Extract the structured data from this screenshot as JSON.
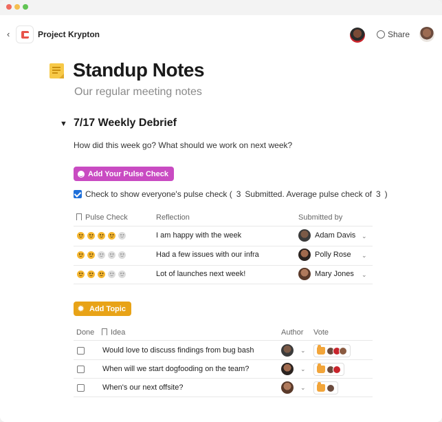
{
  "header": {
    "back_icon": "chevron-left-icon",
    "project_name": "Project Krypton",
    "share_label": "Share",
    "brand_color": "#e8534a"
  },
  "doc": {
    "title": "Standup Notes",
    "subtitle": "Our regular meeting notes",
    "section_title": "7/17 Weekly Debrief",
    "question": "How did this week go? What should we work on next week?"
  },
  "pulse": {
    "button_label": "Add Your Pulse Check",
    "button_color": "#c94bc2",
    "check_text_before": "Check to show everyone's pulse check (",
    "submitted_count": "3",
    "check_text_middle": "Submitted. Average pulse check of",
    "average": "3",
    "check_text_after": ")",
    "checked": true,
    "columns": [
      "Pulse Check",
      "Reflection",
      "Submitted by"
    ],
    "rows": [
      {
        "score": 4,
        "reflection": "I am happy with the week",
        "submitter": "Adam Davis"
      },
      {
        "score": 2,
        "reflection": "Had a few issues with our infra",
        "submitter": "Polly Rose"
      },
      {
        "score": 3,
        "reflection": "Lot of launches next week!",
        "submitter": "Mary Jones"
      }
    ]
  },
  "topics": {
    "button_label": "Add Topic",
    "button_color": "#e8a317",
    "columns": [
      "Done",
      "Idea",
      "Author",
      "Vote"
    ],
    "rows": [
      {
        "idea": "Would love to discuss findings from bug bash",
        "voters": 3
      },
      {
        "idea": "When will we start dogfooding on the team?",
        "voters": 2
      },
      {
        "idea": "When's our next offsite?",
        "voters": 1
      }
    ]
  }
}
